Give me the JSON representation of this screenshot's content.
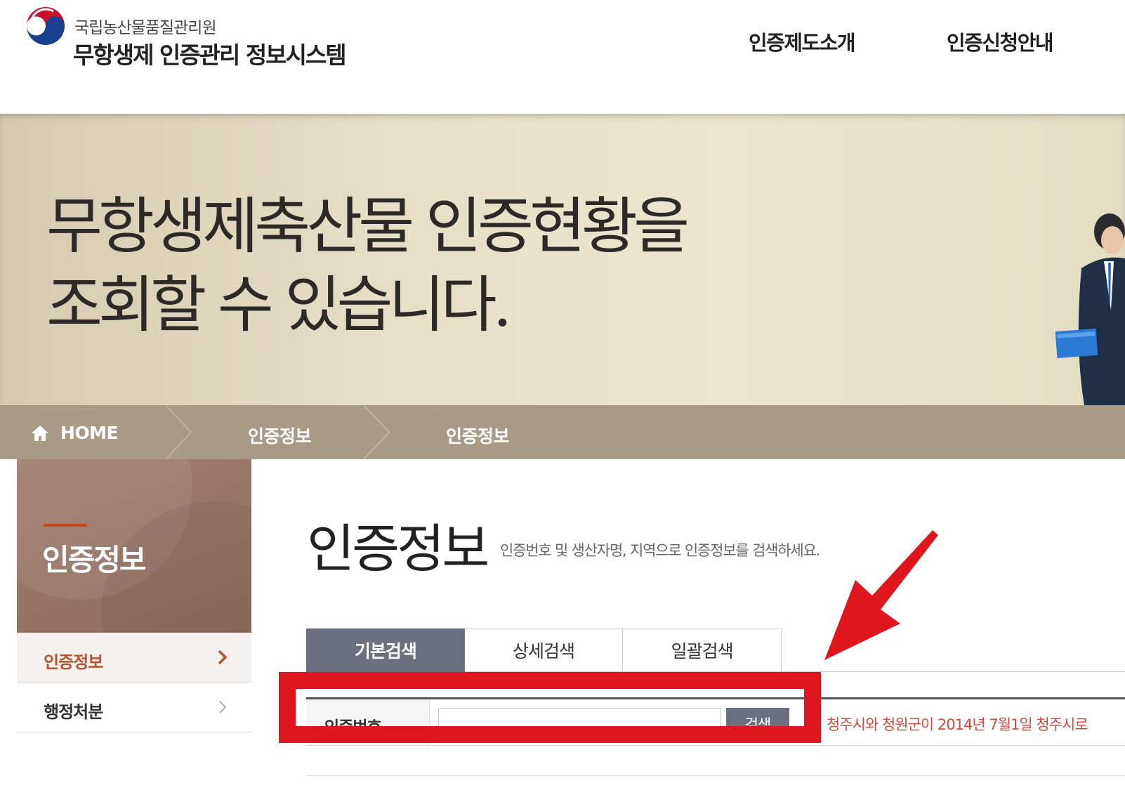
{
  "header": {
    "org_name": "국립농산물품질관리원",
    "system_name": "무항생제 인증관리 정보시스템",
    "nav": [
      {
        "label": "인증제도소개"
      },
      {
        "label": "인증신청안내"
      }
    ]
  },
  "banner": {
    "line1": "무항생제축산물 인증현황을",
    "line2": "조회할 수 있습니다."
  },
  "breadcrumb": {
    "home": "HOME",
    "items": [
      "인증정보",
      "인증정보"
    ]
  },
  "sidebar": {
    "title": "인증정보",
    "items": [
      {
        "label": "인증정보",
        "active": true
      },
      {
        "label": "행정처분",
        "active": false
      }
    ]
  },
  "content": {
    "title": "인증정보",
    "description": "인증번호 및 생산자명, 지역으로 인증정보를 검색하세요.",
    "tabs": [
      {
        "label": "기본검색",
        "active": true
      },
      {
        "label": "상세검색",
        "active": false
      },
      {
        "label": "일괄검색",
        "active": false
      }
    ],
    "search": {
      "field_label": "인증번호",
      "input_value": "",
      "button_label": "검색"
    },
    "notice": "청주시와 청원군이 2014년 7월1일 청주시로"
  },
  "colors": {
    "accent_red": "#e0161e",
    "tab_active": "#6c6f80",
    "menu_active_text": "#b4542a",
    "locbar": "#a89a85",
    "notice": "#d24b3a"
  },
  "icons": {
    "logo": "korea-government-emblem-icon",
    "home": "home-icon",
    "menu_arrow": "chevron-right-icon",
    "annotation": "red-arrow-icon"
  }
}
